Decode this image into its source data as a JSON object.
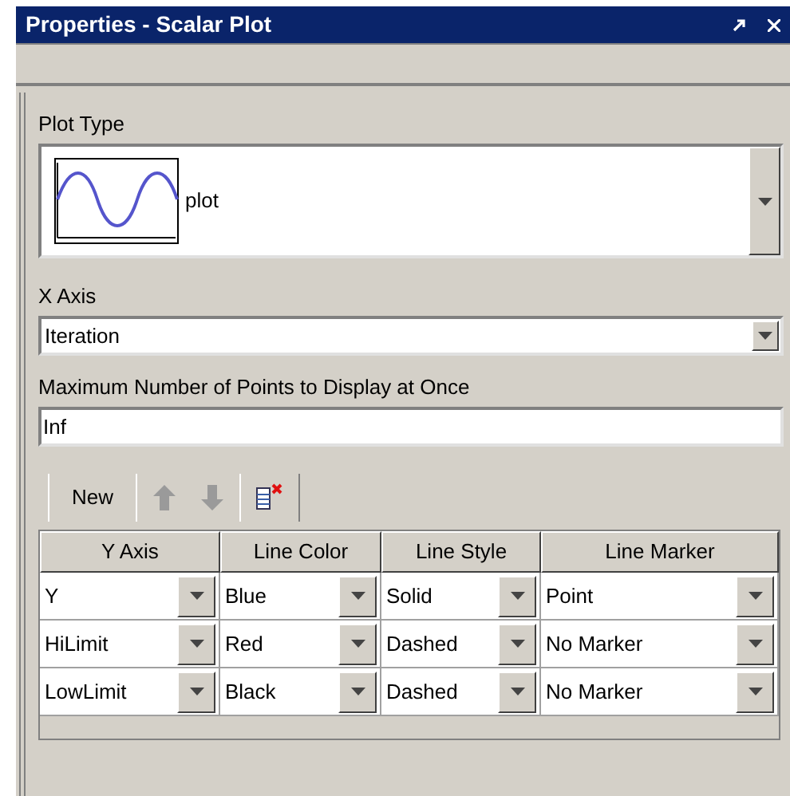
{
  "window": {
    "title": "Properties - Scalar Plot"
  },
  "plot_type": {
    "label": "Plot Type",
    "value": "plot"
  },
  "x_axis": {
    "label": "X Axis",
    "value": "Iteration"
  },
  "max_points": {
    "label": "Maximum Number of Points to Display at Once",
    "value": "Inf"
  },
  "toolbar": [
    {
      "kind": "text",
      "label": "New",
      "disabled": false
    },
    {
      "kind": "up",
      "disabled": true
    },
    {
      "kind": "down",
      "disabled": true
    },
    {
      "kind": "delete",
      "disabled": false
    }
  ],
  "table": {
    "columns": [
      "Y Axis",
      "Line Color",
      "Line Style",
      "Line Marker"
    ],
    "rows": [
      [
        "Y",
        "Blue",
        "Solid",
        "Point"
      ],
      [
        "HiLimit",
        "Red",
        "Dashed",
        "No Marker"
      ],
      [
        "LowLimit",
        "Black",
        "Dashed",
        "No Marker"
      ]
    ]
  }
}
